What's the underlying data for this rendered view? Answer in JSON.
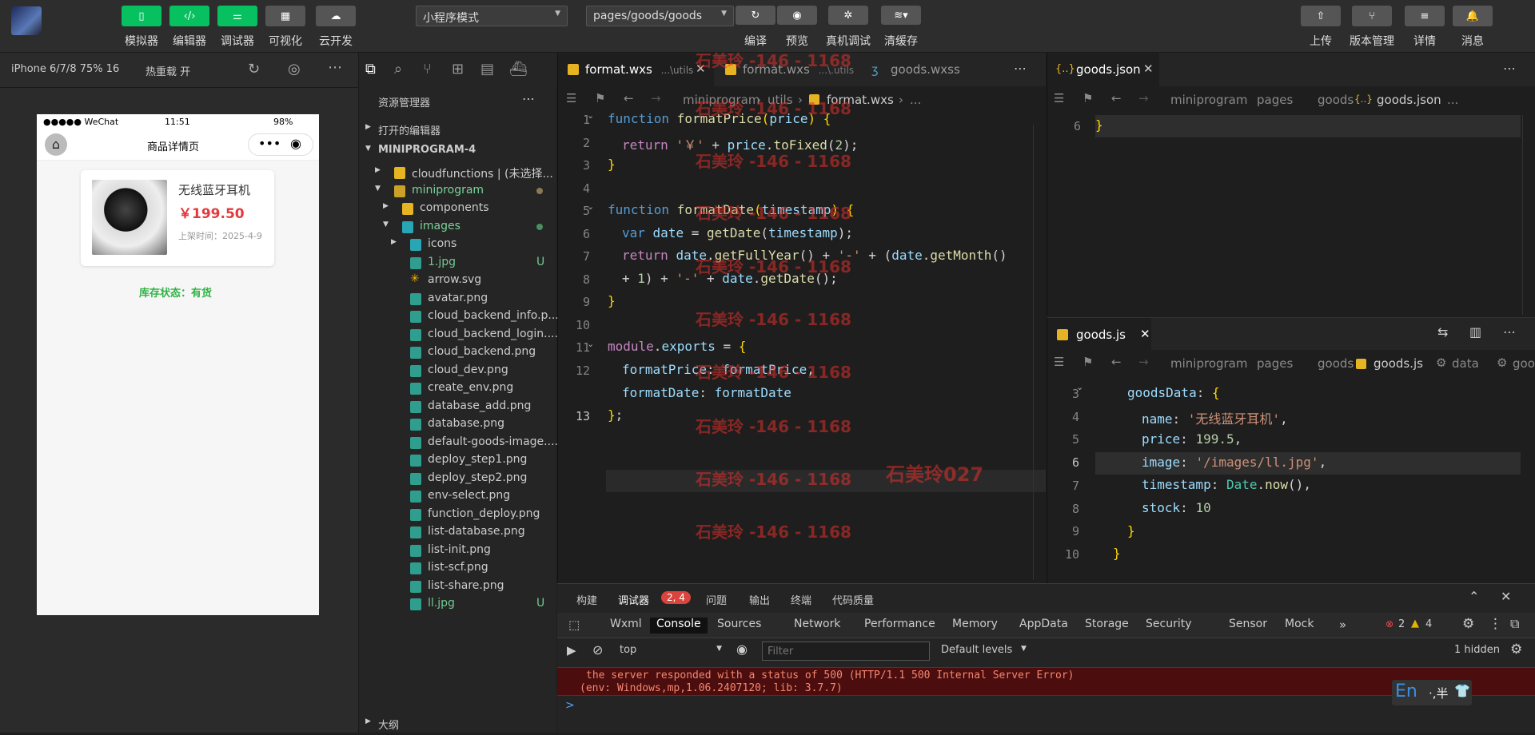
{
  "toolbar": {
    "buttons": [
      {
        "label": "模拟器",
        "icon": "phone-icon"
      },
      {
        "label": "编辑器",
        "icon": "code-icon"
      },
      {
        "label": "调试器",
        "icon": "debug-sliders-icon"
      },
      {
        "label": "可视化",
        "icon": "layout-icon"
      },
      {
        "label": "云开发",
        "icon": "cloud-icon"
      }
    ],
    "mode_select": "小程序模式",
    "page_select": "pages/goods/goods",
    "center_actions": [
      "编译",
      "预览",
      "真机调试",
      "清缓存"
    ],
    "right_actions": [
      "上传",
      "版本管理",
      "详情",
      "消息"
    ]
  },
  "sim": {
    "device": "iPhone 6/7/8 75% 16",
    "hot_reload": "热重载 开",
    "status_carrier": "●●●●● WeChat",
    "status_time": "11:51",
    "status_battery": "98%",
    "nav_title": "商品详情页",
    "product": {
      "name": "无线蓝牙耳机",
      "price": "￥199.50",
      "date": "上架时间：2025-4-9",
      "stock": "库存状态：有货"
    }
  },
  "explorer": {
    "title": "资源管理器",
    "open_editors": "打开的编辑器",
    "project": "MINIPROGRAM-4",
    "items": [
      {
        "label": "cloudfunctions | (未选择...",
        "type": "folder-yellow"
      },
      {
        "label": "miniprogram",
        "type": "folder-open",
        "highlight": true
      },
      {
        "label": "components",
        "type": "folder-yellow"
      },
      {
        "label": "images",
        "type": "folder-teal",
        "highlight": true
      },
      {
        "label": "icons",
        "type": "folder-teal"
      },
      {
        "label": "1.jpg",
        "type": "image",
        "status": "U",
        "green": true
      },
      {
        "label": "arrow.svg",
        "type": "svg"
      },
      {
        "label": "avatar.png",
        "type": "image"
      },
      {
        "label": "cloud_backend_info.p...",
        "type": "image"
      },
      {
        "label": "cloud_backend_login....",
        "type": "image"
      },
      {
        "label": "cloud_backend.png",
        "type": "image"
      },
      {
        "label": "cloud_dev.png",
        "type": "image"
      },
      {
        "label": "create_env.png",
        "type": "image"
      },
      {
        "label": "database_add.png",
        "type": "image"
      },
      {
        "label": "database.png",
        "type": "image"
      },
      {
        "label": "default-goods-image....",
        "type": "image"
      },
      {
        "label": "deploy_step1.png",
        "type": "image"
      },
      {
        "label": "deploy_step2.png",
        "type": "image"
      },
      {
        "label": "env-select.png",
        "type": "image"
      },
      {
        "label": "function_deploy.png",
        "type": "image"
      },
      {
        "label": "list-database.png",
        "type": "image"
      },
      {
        "label": "list-init.png",
        "type": "image"
      },
      {
        "label": "list-scf.png",
        "type": "image"
      },
      {
        "label": "list-share.png",
        "type": "image"
      },
      {
        "label": "ll.jpg",
        "type": "image",
        "status": "U",
        "green": true
      }
    ],
    "outline": "大纲"
  },
  "editor1": {
    "tabs": [
      {
        "name": "format.wxs",
        "path": "...\\utils",
        "active": true
      },
      {
        "name": "format.wxs",
        "path": "...\\.utils",
        "active": false
      },
      {
        "name": "goods.wxss",
        "path": "",
        "active": false
      }
    ],
    "breadcrumb": [
      "miniprogram",
      "utils",
      "format.wxs",
      "..."
    ],
    "line_numbers": [
      "1",
      "2",
      "3",
      "4",
      "5",
      "6",
      "7",
      "8",
      "9",
      "10",
      "11",
      "12",
      "13"
    ]
  },
  "editor2": {
    "tab": "goods.json",
    "breadcrumb": [
      "miniprogram",
      "pages",
      "goods",
      "goods.json",
      "..."
    ],
    "line_number": "6",
    "code": "}"
  },
  "editor3": {
    "tab": "goods.js",
    "breadcrumb": [
      "miniprogram",
      "pages",
      "goods",
      "goods.js",
      "data",
      "goo"
    ],
    "line_numbers": [
      "3",
      "4",
      "5",
      "6",
      "7",
      "8",
      "9",
      "10"
    ]
  },
  "watermark": {
    "text": "石美玲 -146 - 1168",
    "extra": "石美玲027"
  },
  "devtools": {
    "top_tabs": [
      "构建",
      "调试器",
      "问题",
      "输出",
      "终端",
      "代码质量"
    ],
    "badge": "2, 4",
    "panel_tabs": [
      "Wxml",
      "Console",
      "Sources",
      "Network",
      "Performance",
      "Memory",
      "AppData",
      "Storage",
      "Security",
      "Sensor",
      "Mock"
    ],
    "more": "»",
    "errors": "2",
    "warnings": "4",
    "context": "top",
    "filter_placeholder": "Filter",
    "levels": "Default levels",
    "hidden": "1 hidden",
    "log_line1": "the server responded with a status of 500 (HTTP/1.1 500 Internal Server Error)",
    "log_line2": "(env: Windows,mp,1.06.2407120; lib: 3.7.7)",
    "prompt": ">",
    "ime": "En",
    "ime_extra": "·,半"
  },
  "colors": {
    "accent_green": "#07c160",
    "price_red": "#e4393c",
    "error_bg": "#4b0d0d"
  }
}
